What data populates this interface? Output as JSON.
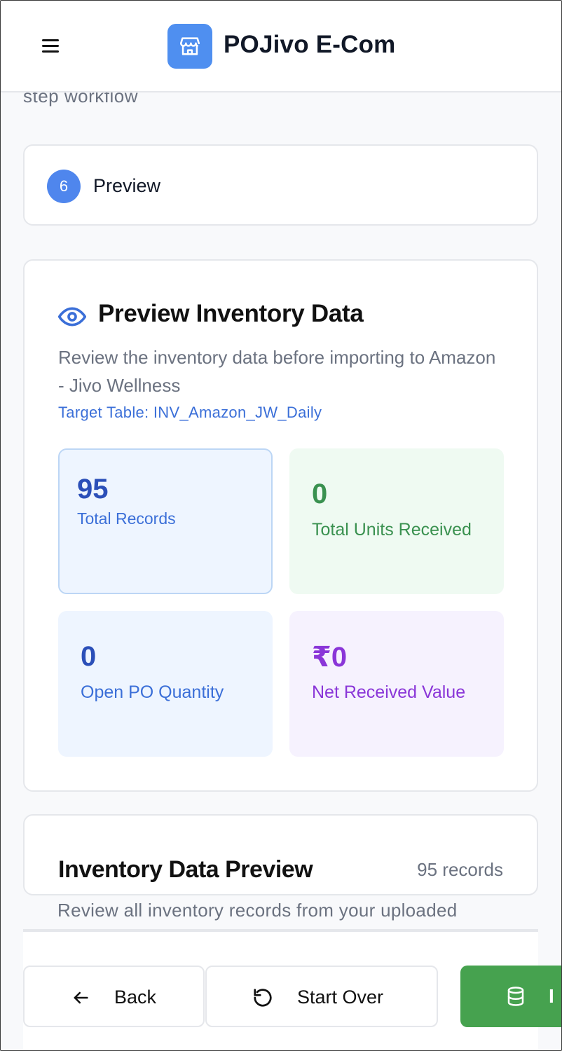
{
  "header": {
    "app_title": "POJivo E-Com",
    "menu_icon": "hamburger-icon",
    "logo_icon": "store-icon"
  },
  "intro": {
    "partial_text": "step workflow"
  },
  "step": {
    "number": "6",
    "label": "Preview"
  },
  "preview": {
    "title": "Preview Inventory Data",
    "description": "Review the inventory data before importing to Amazon - Jivo Wellness",
    "target_table": "Target Table: INV_Amazon_JW_Daily",
    "stats": [
      {
        "value": "95",
        "label": "Total Records"
      },
      {
        "value": "0",
        "label": "Total Units Received"
      },
      {
        "value": "0",
        "label": "Open PO Quantity"
      },
      {
        "value": "₹0",
        "label": "Net Received Value"
      }
    ]
  },
  "inventory": {
    "title": "Inventory Data Preview",
    "count": "95 records",
    "description": "Review all inventory records from your uploaded"
  },
  "actions": {
    "back": "Back",
    "start_over": "Start Over",
    "import_partial": "I"
  },
  "colors": {
    "accent": "#4f86ed",
    "success": "#46a24f",
    "purple": "#8a36d8"
  }
}
